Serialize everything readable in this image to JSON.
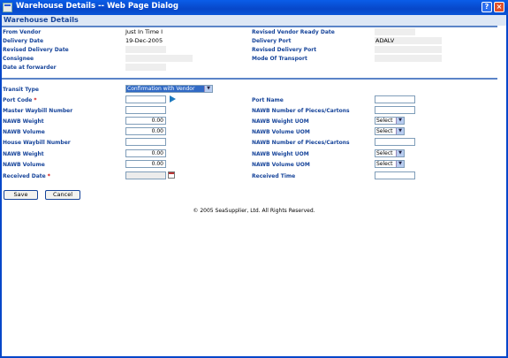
{
  "window": {
    "title": "Warehouse Details -- Web Page Dialog",
    "help_glyph": "?",
    "close_glyph": "×"
  },
  "section_title": "Warehouse Details",
  "summary": {
    "from_vendor_label": "From Vendor",
    "from_vendor_value": "Just In Time I",
    "revised_vendor_ready_label": "Revised Vendor Ready Date",
    "revised_vendor_ready_value": "",
    "delivery_date_label": "Delivery Date",
    "delivery_date_value": "19-Dec-2005",
    "delivery_port_label": "Delivery Port",
    "delivery_port_value": "ADALV",
    "revised_delivery_date_label": "Revised Delivery Date",
    "revised_delivery_date_value": "",
    "revised_delivery_port_label": "Revised Delivery Port",
    "revised_delivery_port_value": "",
    "consignee_label": "Consignee",
    "consignee_value": "",
    "mode_of_transport_label": "Mode Of Transport",
    "mode_of_transport_value": "",
    "date_at_forwarder_label": "Date at forwarder",
    "date_at_forwarder_value": ""
  },
  "form": {
    "transit_type_label": "Transit Type",
    "transit_type_value": "Confirmation with Vendor",
    "port_code_label": "Port Code",
    "port_code_value": "",
    "port_name_label": "Port Name",
    "port_name_value": "",
    "master_waybill_label": "Master Waybill Number",
    "master_waybill_value": "",
    "nawb_pieces_label_1": "NAWB Number of Pieces/Cartons",
    "nawb_pieces_value_1": "",
    "nawb_weight_label_1": "NAWB Weight",
    "nawb_weight_value_1": "0.00",
    "nawb_weight_uom_label_1": "NAWB Weight UOM",
    "nawb_weight_uom_value_1": "Select",
    "nawb_volume_label_1": "NAWB Volume",
    "nawb_volume_value_1": "0.00",
    "nawb_volume_uom_label_1": "NAWB Volume UOM",
    "nawb_volume_uom_value_1": "Select",
    "house_waybill_label": "House Waybill Number",
    "house_waybill_value": "",
    "nawb_pieces_label_2": "NAWB Number of Pieces/Cartons",
    "nawb_pieces_value_2": "",
    "nawb_weight_label_2": "NAWB Weight",
    "nawb_weight_value_2": "0.00",
    "nawb_weight_uom_label_2": "NAWB Weight UOM",
    "nawb_weight_uom_value_2": "Select",
    "nawb_volume_label_2": "NAWB Volume",
    "nawb_volume_value_2": "0.00",
    "nawb_volume_uom_label_2": "NAWB Volume UOM",
    "nawb_volume_uom_value_2": "Select",
    "received_date_label": "Received Date",
    "received_date_value": "",
    "received_time_label": "Received Time",
    "received_time_value": "",
    "required_marker": "*"
  },
  "buttons": {
    "save": "Save",
    "cancel": "Cancel"
  },
  "footer": {
    "copyright": "© 2005 SeaSupplier, Ltd. All Rights Reserved."
  },
  "icons": {
    "dropdown_arrow": "▼",
    "port_lookup": "arrow-icon",
    "calendar": "calendar-icon"
  },
  "colors": {
    "titlebar": "#0747c9",
    "label": "#16449a",
    "header_bg": "#dde7f5",
    "selected": "#316ac5"
  }
}
